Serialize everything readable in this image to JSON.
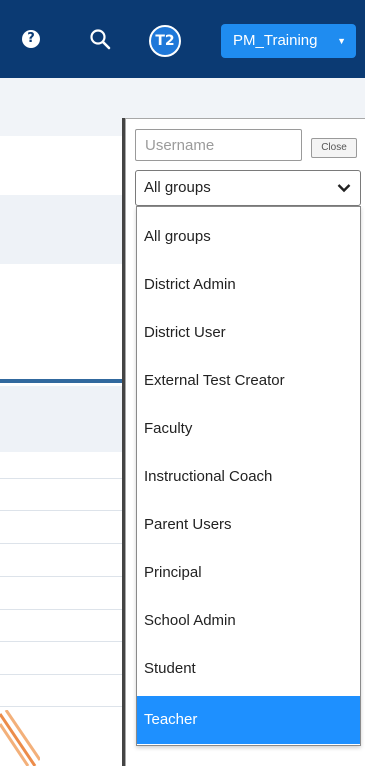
{
  "topbar": {
    "help_glyph": "?",
    "avatar_initials": "T2",
    "account_label": "PM_Training",
    "account_caret": "▼",
    "colors": {
      "bar": "#0b3a73",
      "account_button": "#1f8cf0",
      "avatar": "#1f78d9"
    }
  },
  "icons": [
    "help-icon",
    "search-icon",
    "chevron-down-icon"
  ],
  "filter": {
    "username_placeholder": "Username",
    "username_value": "",
    "close_label": "Close",
    "group_select_value": "All groups"
  },
  "dropdown": {
    "options": [
      {
        "label": "All groups"
      },
      {
        "label": "District Admin"
      },
      {
        "label": "District User"
      },
      {
        "label": "External Test Creator"
      },
      {
        "label": "Faculty"
      },
      {
        "label": "Instructional Coach"
      },
      {
        "label": "Parent Users"
      },
      {
        "label": "Principal"
      },
      {
        "label": "School Admin"
      },
      {
        "label": "Student"
      },
      {
        "label": "Teacher",
        "selected": true
      }
    ],
    "highlight_color": "#1e90ff"
  }
}
